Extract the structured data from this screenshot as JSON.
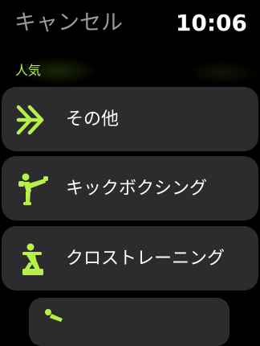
{
  "header": {
    "cancel_label": "キャンセル",
    "time": "10:06"
  },
  "section": {
    "title": "人気"
  },
  "workouts": [
    {
      "label": "その他",
      "icon": "double-chevron-right-icon"
    },
    {
      "label": "キックボクシング",
      "icon": "kickboxing-figure-icon"
    },
    {
      "label": "クロストレーニング",
      "icon": "cross-training-figure-icon"
    },
    {
      "label": "",
      "icon": "workout-figure-icon"
    }
  ],
  "colors": {
    "accent": "#b8f04a",
    "card_background": "#2c2c2e",
    "cancel_text": "#9a9a9a",
    "background": "#000000"
  }
}
